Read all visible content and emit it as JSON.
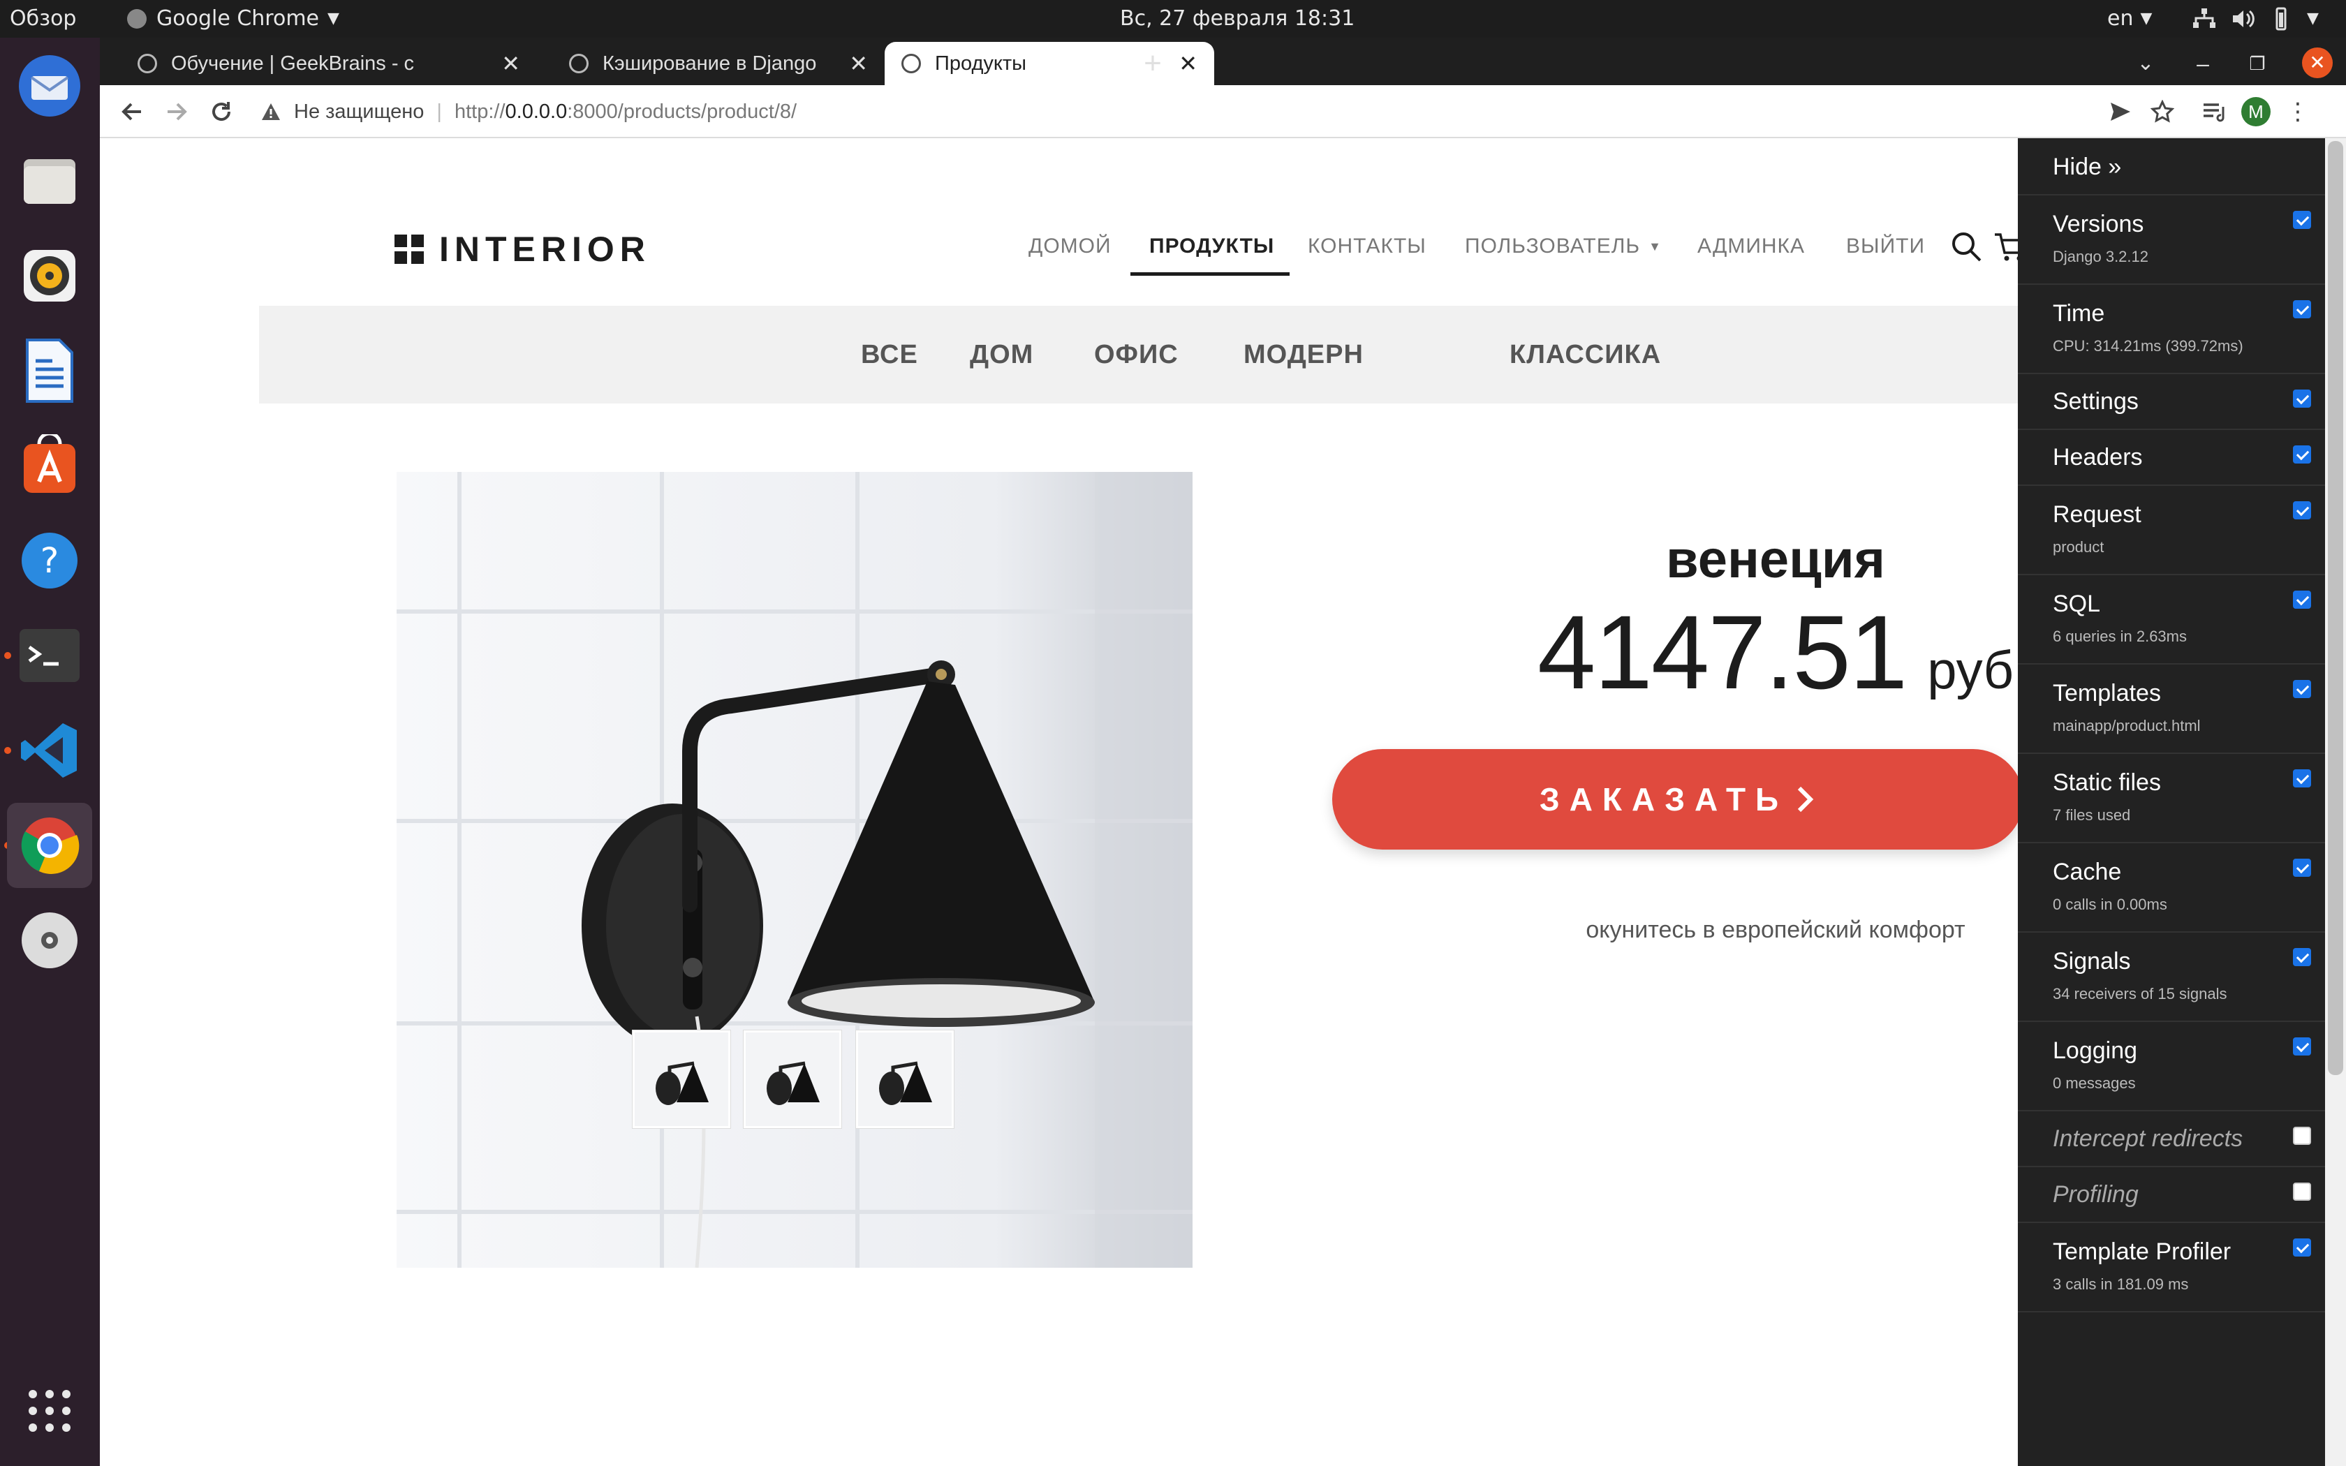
{
  "system_bar": {
    "activities": "Обзор",
    "app_menu": "Google Chrome",
    "clock": "Вс, 27 февраля  18:31",
    "lang": "en"
  },
  "dock": {
    "items": [
      {
        "name": "thunderbird-icon",
        "active": false
      },
      {
        "name": "files-icon",
        "active": false
      },
      {
        "name": "rhythmbox-icon",
        "active": false
      },
      {
        "name": "writer-icon",
        "active": false
      },
      {
        "name": "software-icon",
        "active": false
      },
      {
        "name": "help-icon",
        "active": false
      },
      {
        "name": "terminal-icon",
        "active": false,
        "running": true
      },
      {
        "name": "vscode-icon",
        "active": false,
        "running": true
      },
      {
        "name": "chrome-icon",
        "active": true,
        "running": true
      },
      {
        "name": "disc-icon",
        "active": false
      }
    ]
  },
  "browser": {
    "tabs": [
      {
        "title": "Обучение | GeekBrains - с",
        "active": false
      },
      {
        "title": "Кэширование в Django",
        "active": false
      },
      {
        "title": "Продукты",
        "active": true
      }
    ],
    "security_label": "Не защищено",
    "url_prefix": "http://",
    "url_host": "0.0.0.0",
    "url_rest": ":8000/products/product/8/",
    "profile_initial": "M"
  },
  "site": {
    "logo_text": "INTERIOR",
    "nav": {
      "home": "ДОМОЙ",
      "products": "ПРОДУКТЫ",
      "contacts": "КОНТАКТЫ",
      "user": "ПОЛЬЗОВАТЕЛЬ",
      "admin": "АДМИНКА",
      "logout": "ВЫЙТИ"
    },
    "categories": [
      "ВСЕ",
      "ДОМ",
      "ОФИС",
      "МОДЕРН",
      "КЛАССИКА"
    ],
    "product": {
      "title": "венеция",
      "price": "4147.51",
      "currency": "руб",
      "order_label": "ЗАКАЗАТЬ",
      "subtitle": "окунитесь в европейский комфорт"
    }
  },
  "debug_toolbar": {
    "hide_label": "Hide »",
    "panels": [
      {
        "name": "Versions",
        "sub": "Django 3.2.12",
        "checked": true,
        "italic": false
      },
      {
        "name": "Time",
        "sub": "CPU: 314.21ms (399.72ms)",
        "checked": true,
        "italic": false
      },
      {
        "name": "Settings",
        "sub": "",
        "checked": true,
        "italic": false
      },
      {
        "name": "Headers",
        "sub": "",
        "checked": true,
        "italic": false
      },
      {
        "name": "Request",
        "sub": "product",
        "checked": true,
        "italic": false
      },
      {
        "name": "SQL",
        "sub": "6 queries in 2.63ms",
        "checked": true,
        "italic": false
      },
      {
        "name": "Templates",
        "sub": "mainapp/product.html",
        "checked": true,
        "italic": false
      },
      {
        "name": "Static files",
        "sub": "7 files used",
        "checked": true,
        "italic": false
      },
      {
        "name": "Cache",
        "sub": "0 calls in 0.00ms",
        "checked": true,
        "italic": false
      },
      {
        "name": "Signals",
        "sub": "34 receivers of 15 signals",
        "checked": true,
        "italic": false
      },
      {
        "name": "Logging",
        "sub": "0 messages",
        "checked": true,
        "italic": false
      },
      {
        "name": "Intercept redirects",
        "sub": "",
        "checked": false,
        "italic": true
      },
      {
        "name": "Profiling",
        "sub": "",
        "checked": false,
        "italic": true
      },
      {
        "name": "Template Profiler",
        "sub": "3 calls in 181.09 ms",
        "checked": true,
        "italic": false
      }
    ]
  },
  "colors": {
    "accent": "#e04a3e",
    "dock_bg": "#2c1f2b",
    "toolbar_bg": "#222222",
    "ubuntu_orange": "#e95420"
  }
}
